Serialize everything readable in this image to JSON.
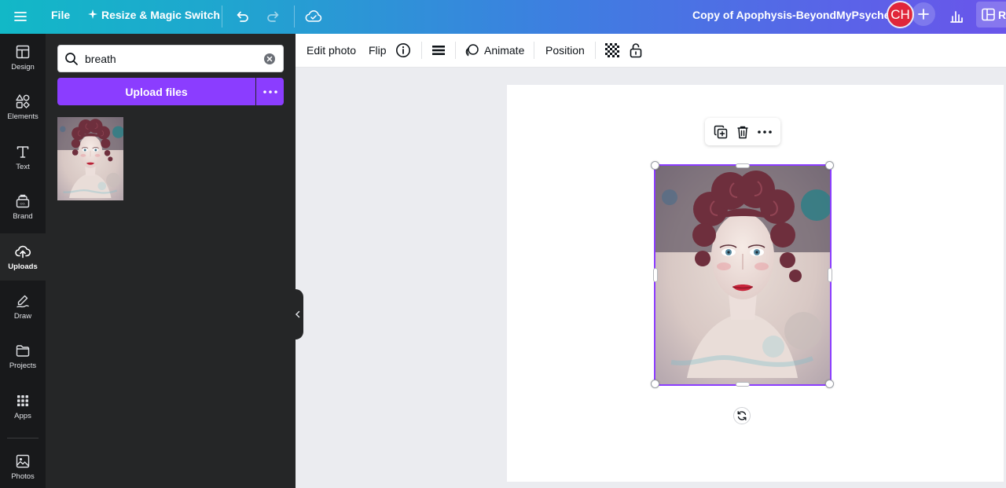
{
  "topbar": {
    "menu_icon": "hamburger-icon",
    "file_label": "File",
    "resize_label": "Resize & Magic Switch",
    "doc_title": "Copy of Apophysis-BeyondMyPsyche",
    "avatar_initials": "CH",
    "edge_button_label": "R",
    "gradient_start": "#12b8c7",
    "gradient_end": "#6a55ea"
  },
  "rail": {
    "items": [
      {
        "label": "Design",
        "icon": "design-icon"
      },
      {
        "label": "Elements",
        "icon": "elements-icon"
      },
      {
        "label": "Text",
        "icon": "text-icon"
      },
      {
        "label": "Brand",
        "icon": "brand-icon"
      },
      {
        "label": "Uploads",
        "icon": "upload-cloud-icon"
      },
      {
        "label": "Draw",
        "icon": "draw-icon"
      },
      {
        "label": "Projects",
        "icon": "folder-icon"
      },
      {
        "label": "Apps",
        "icon": "apps-grid-icon"
      },
      {
        "label": "Photos",
        "icon": "photo-icon"
      }
    ],
    "active": "Uploads"
  },
  "panel": {
    "search_value": "breath",
    "upload_label": "Upload files",
    "accent": "#8b3dff"
  },
  "ctxbar": {
    "edit_photo": "Edit photo",
    "flip": "Flip",
    "animate": "Animate",
    "position": "Position"
  }
}
